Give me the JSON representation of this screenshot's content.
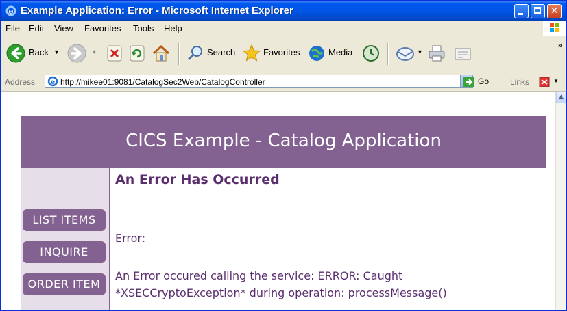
{
  "window": {
    "title": "Example Application: Error - Microsoft Internet Explorer"
  },
  "menu": [
    "File",
    "Edit",
    "View",
    "Favorites",
    "Tools",
    "Help"
  ],
  "toolbar": {
    "back_label": "Back",
    "search_label": "Search",
    "favorites_label": "Favorites",
    "media_label": "Media"
  },
  "address": {
    "label": "Address",
    "url": "http://mikee01:9081/CatalogSec2Web/CatalogController",
    "go_label": "Go",
    "links_label": "Links"
  },
  "page": {
    "banner_title": "CICS Example - Catalog Application",
    "heading": "An Error Has Occurred",
    "nav": [
      "LIST ITEMS",
      "INQUIRE",
      "ORDER ITEM"
    ],
    "error_label": "Error:",
    "error_line1": "An Error occured calling the service: ERROR: Caught",
    "error_line2": "*XSECCryptoException* during operation: processMessage()"
  },
  "colors": {
    "banner": "#836292",
    "sidebar": "#e6dfea",
    "text": "#5b2f6e",
    "titlebar": "#0055e5"
  }
}
